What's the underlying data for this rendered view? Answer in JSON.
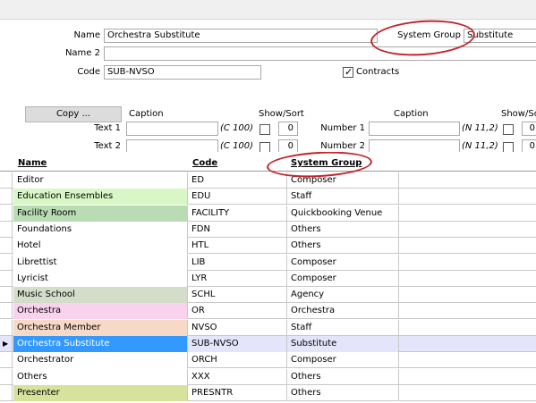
{
  "form": {
    "name_label": "Name",
    "name_value": "Orchestra Substitute",
    "name2_label": "Name 2",
    "name2_value": "",
    "code_label": "Code",
    "code_value": "SUB-NVSO",
    "contracts_label": "Contracts",
    "contracts_checked": true,
    "system_group_label": "System Group",
    "system_group_value": "Substitute",
    "copy_button": "Copy ...",
    "caption_label_left": "Caption",
    "show_sort_label_left": "Show/Sort",
    "caption_label_right": "Caption",
    "show_sort_label_right": "Show/So",
    "text_fields": [
      {
        "label": "Text 1",
        "type": "(C 100)",
        "sort": "0"
      },
      {
        "label": "Text 2",
        "type": "(C 100)",
        "sort": "0"
      }
    ],
    "number_fields": [
      {
        "label": "Number 1",
        "type": "(N 11,2)",
        "sort": "0"
      },
      {
        "label": "Number 2",
        "type": "(N 11,2)",
        "sort": "0"
      }
    ]
  },
  "grid": {
    "headers": {
      "name": "Name",
      "code": "Code",
      "system_group": "System Group"
    },
    "rows": [
      {
        "name": "Editor",
        "code": "ED",
        "group": "Composer",
        "color": "#ffffff"
      },
      {
        "name": "Education Ensembles",
        "code": "EDU",
        "group": "Staff",
        "color": "#d9f7c6"
      },
      {
        "name": "Facility Room",
        "code": "FACILITY",
        "group": "Quickbooking Venue",
        "color": "#b9dcb4"
      },
      {
        "name": "Foundations",
        "code": "FDN",
        "group": "Others",
        "color": "#ffffff"
      },
      {
        "name": "Hotel",
        "code": "HTL",
        "group": "Others",
        "color": "#ffffff"
      },
      {
        "name": "Librettist",
        "code": "LIB",
        "group": "Composer",
        "color": "#ffffff"
      },
      {
        "name": "Lyricist",
        "code": "LYR",
        "group": "Composer",
        "color": "#ffffff"
      },
      {
        "name": "Music School",
        "code": "SCHL",
        "group": "Agency",
        "color": "#d3ddc9"
      },
      {
        "name": "Orchestra",
        "code": "OR",
        "group": "Orchestra",
        "color": "#f9d3ee"
      },
      {
        "name": "Orchestra Member",
        "code": "NVSO",
        "group": "Staff",
        "color": "#f7d9c8"
      },
      {
        "name": "Orchestra Substitute",
        "code": "SUB-NVSO",
        "group": "Substitute",
        "color": "#3399ff",
        "selected": true
      },
      {
        "name": "Orchestrator",
        "code": "ORCH",
        "group": "Composer",
        "color": "#ffffff"
      },
      {
        "name": "Others",
        "code": "XXX",
        "group": "Others",
        "color": "#ffffff"
      },
      {
        "name": "Presenter",
        "code": "PRESNTR",
        "group": "Others",
        "color": "#d7e39c"
      }
    ],
    "selected_row_fill": "#e4e4fb",
    "selected_indicator": "▶"
  },
  "colors": {
    "highlight_ellipse": "#c0262d",
    "selection": "#3399ff"
  }
}
